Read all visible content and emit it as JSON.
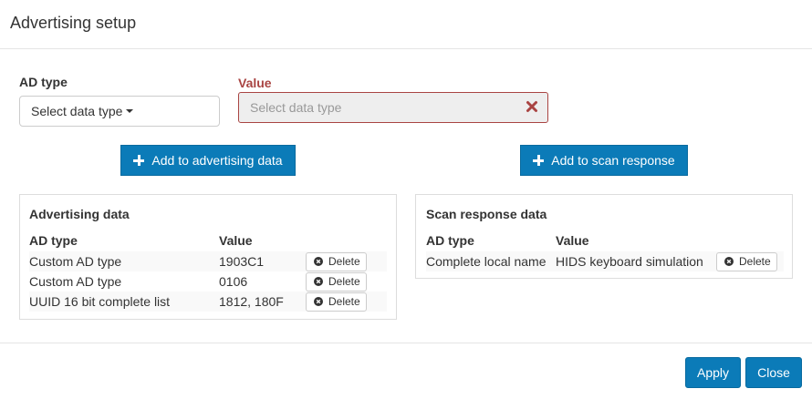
{
  "dialog": {
    "title": "Advertising setup"
  },
  "form": {
    "ad_type_label": "AD type",
    "ad_type_select": "Select data type",
    "value_label": "Value",
    "value_placeholder": "Select data type"
  },
  "buttons": {
    "add_advertising": "Add to advertising data",
    "add_scan": "Add to scan response",
    "apply": "Apply",
    "close": "Close"
  },
  "advertising": {
    "title": "Advertising data",
    "headers": {
      "type": "AD type",
      "value": "Value"
    },
    "rows": [
      {
        "type": "Custom AD type",
        "value": "1903C1",
        "action": "Delete"
      },
      {
        "type": "Custom AD type",
        "value": "0106",
        "action": "Delete"
      },
      {
        "type": "UUID 16 bit complete list",
        "value": "1812, 180F",
        "action": "Delete"
      }
    ]
  },
  "scan_response": {
    "title": "Scan response data",
    "headers": {
      "type": "AD type",
      "value": "Value"
    },
    "rows": [
      {
        "type": "Complete local name",
        "value": "HIDS keyboard simulation",
        "action": "Delete"
      }
    ]
  },
  "colors": {
    "primary": "#0b7bb8",
    "error": "#a94442"
  },
  "icons": {
    "caret": "caret-down-icon",
    "clear": "clear-x-icon",
    "plus": "plus-icon",
    "delete": "times-circle-icon"
  }
}
